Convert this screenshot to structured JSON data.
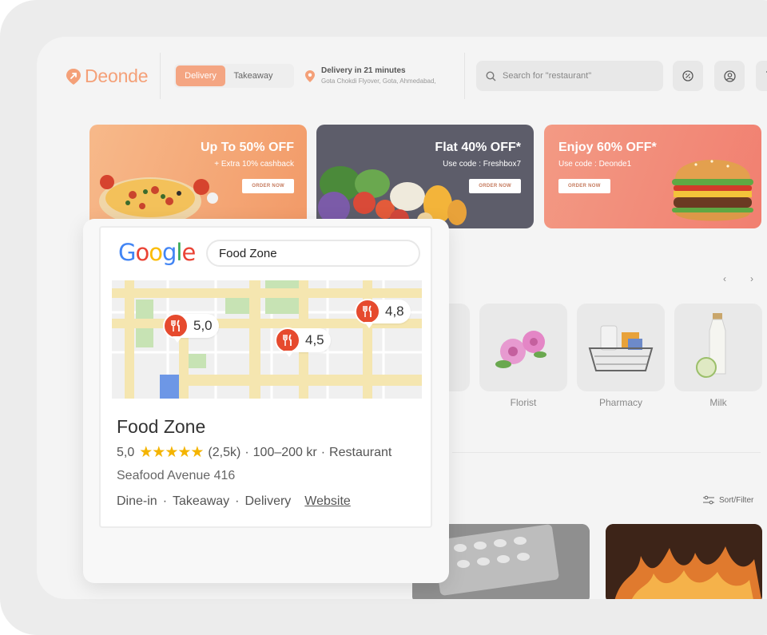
{
  "brand": {
    "name": "Deonde",
    "color": "#f4a078"
  },
  "header": {
    "toggle": {
      "active": "Delivery",
      "inactive": "Takeaway"
    },
    "delivery": {
      "title": "Delivery in 21 minutes",
      "address": "Gota Chokdi Flyover, Gota, Ahmedabad,"
    },
    "search_placeholder": "Search for \"restaurant\"",
    "icons": [
      "discount-icon",
      "user-icon",
      "cart-icon"
    ]
  },
  "banners": [
    {
      "title": "Up To 50% OFF",
      "subtitle": "+ Extra 10% cashback",
      "button": "ORDER NOW",
      "image": "pizza"
    },
    {
      "title": "Flat 40% OFF*",
      "subtitle": "Use code : Freshbox7",
      "button": "ORDER NOW",
      "image": "vegetables"
    },
    {
      "title": "Enjoy 60% OFF*",
      "subtitle": "Use code : Deonde1",
      "button": "ORDER NOW",
      "image": "burger"
    }
  ],
  "categories": [
    {
      "label": "Florist"
    },
    {
      "label": "Pharmacy"
    },
    {
      "label": "Milk"
    }
  ],
  "sort_filter": "Sort/Filter",
  "google_card": {
    "logo": "Google",
    "search_value": "Food Zone",
    "map_pins": [
      {
        "rating": "5,0"
      },
      {
        "rating": "4,5"
      },
      {
        "rating": "4,8"
      }
    ],
    "place": {
      "name": "Food Zone",
      "rating": "5,0",
      "stars": "★★★★★",
      "reviews": "(2,5k)",
      "price": "100–200 kr",
      "type": "Restaurant",
      "address": "Seafood Avenue 416",
      "services": [
        "Dine-in",
        "Takeaway",
        "Delivery"
      ],
      "website": "Website"
    },
    "colors": {
      "pin": "#e64a2e",
      "star": "#f4b400",
      "road": "#f5e6b0",
      "park": "#c7e3b4",
      "water": "#6d97e6"
    }
  }
}
